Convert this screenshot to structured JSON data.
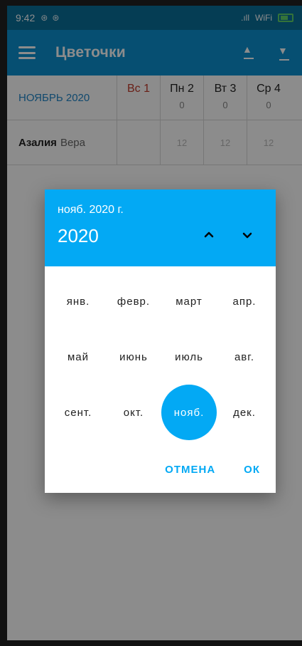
{
  "status": {
    "time": "9:42",
    "left_icons": [
      "⊛",
      "⊛"
    ],
    "right_text": ".ıll",
    "wifi": "WiFi",
    "battery_color": "#5fd16a"
  },
  "appbar": {
    "title": "Цветочки",
    "bg": "#0b91cf"
  },
  "table": {
    "month": "НОЯБРЬ 2020",
    "days": [
      {
        "label": "Вс 1",
        "num": ""
      },
      {
        "label": "Пн 2",
        "num": "0"
      },
      {
        "label": "Вт 3",
        "num": "0"
      },
      {
        "label": "Ср 4",
        "num": "0"
      }
    ],
    "row": {
      "name": "Азалия",
      "sub": "Вера",
      "values": [
        "12",
        "12",
        "12"
      ]
    }
  },
  "dialog": {
    "subtitle": "нояб. 2020 г.",
    "year": "2020",
    "months": [
      "янв.",
      "февр.",
      "март",
      "апр.",
      "май",
      "июнь",
      "июль",
      "авг.",
      "сент.",
      "окт.",
      "нояб.",
      "дек."
    ],
    "selected_index": 10,
    "cancel": "ОТМЕНА",
    "ok": "ОК",
    "accent": "#03a9f4"
  }
}
